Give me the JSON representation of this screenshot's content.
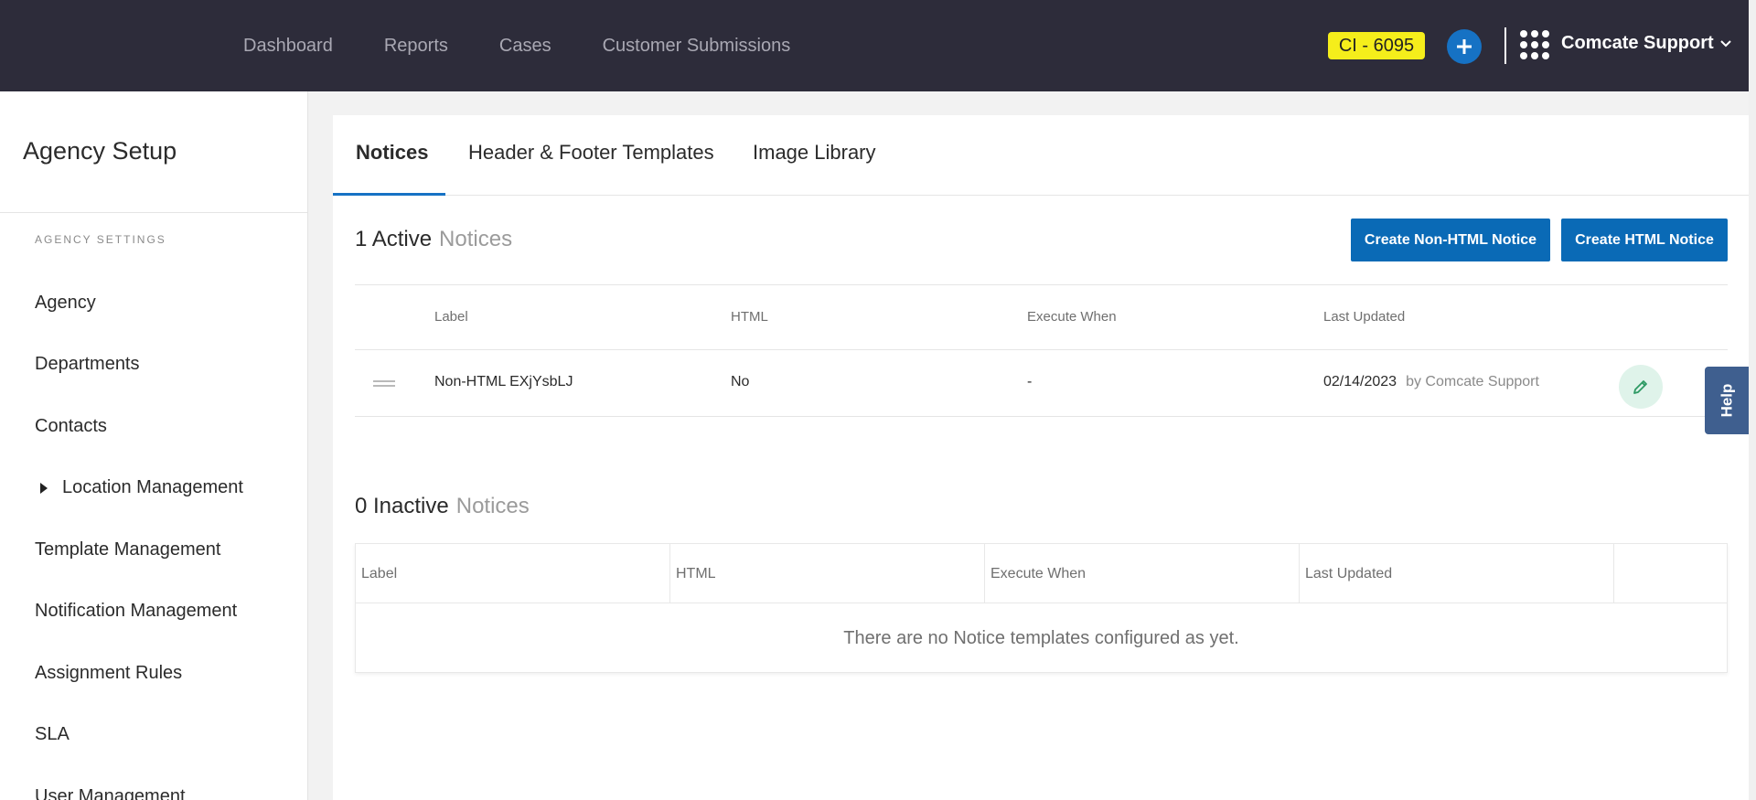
{
  "topbar": {
    "nav": [
      "Dashboard",
      "Reports",
      "Cases",
      "Customer Submissions"
    ],
    "ci_badge": "CI - 6095",
    "user_name": "Comcate Support"
  },
  "sidebar": {
    "title": "Agency Setup",
    "section_label": "AGENCY SETTINGS",
    "items": [
      "Agency",
      "Departments",
      "Contacts",
      "Location Management",
      "Template Management",
      "Notification Management",
      "Assignment Rules",
      "SLA",
      "User Management"
    ]
  },
  "tabs": [
    "Notices",
    "Header & Footer Templates",
    "Image Library"
  ],
  "active_section": {
    "count": "1 Active",
    "label": "Notices",
    "create_non_html": "Create Non-HTML Notice",
    "create_html": "Create HTML Notice",
    "columns": [
      "Label",
      "HTML",
      "Execute When",
      "Last Updated"
    ],
    "rows": [
      {
        "label": "Non-HTML EXjYsbLJ",
        "html": "No",
        "execute_when": "-",
        "last_updated": "02/14/2023",
        "updated_by": "by Comcate Support"
      }
    ]
  },
  "inactive_section": {
    "count": "0 Inactive",
    "label": "Notices",
    "columns": [
      "Label",
      "HTML",
      "Execute When",
      "Last Updated"
    ],
    "empty_message": "There are no Notice templates configured as yet."
  },
  "help_label": "Help",
  "colors": {
    "topbar_bg": "#2d2c3a",
    "accent_blue": "#0a6ab6",
    "badge_yellow": "#f5ee1b",
    "help_tab": "#3f5f8f"
  },
  "icons": [
    "plus-icon",
    "apps-grid-icon",
    "chevron-down-icon",
    "caret-right-icon",
    "drag-handle-icon",
    "pencil-icon"
  ]
}
